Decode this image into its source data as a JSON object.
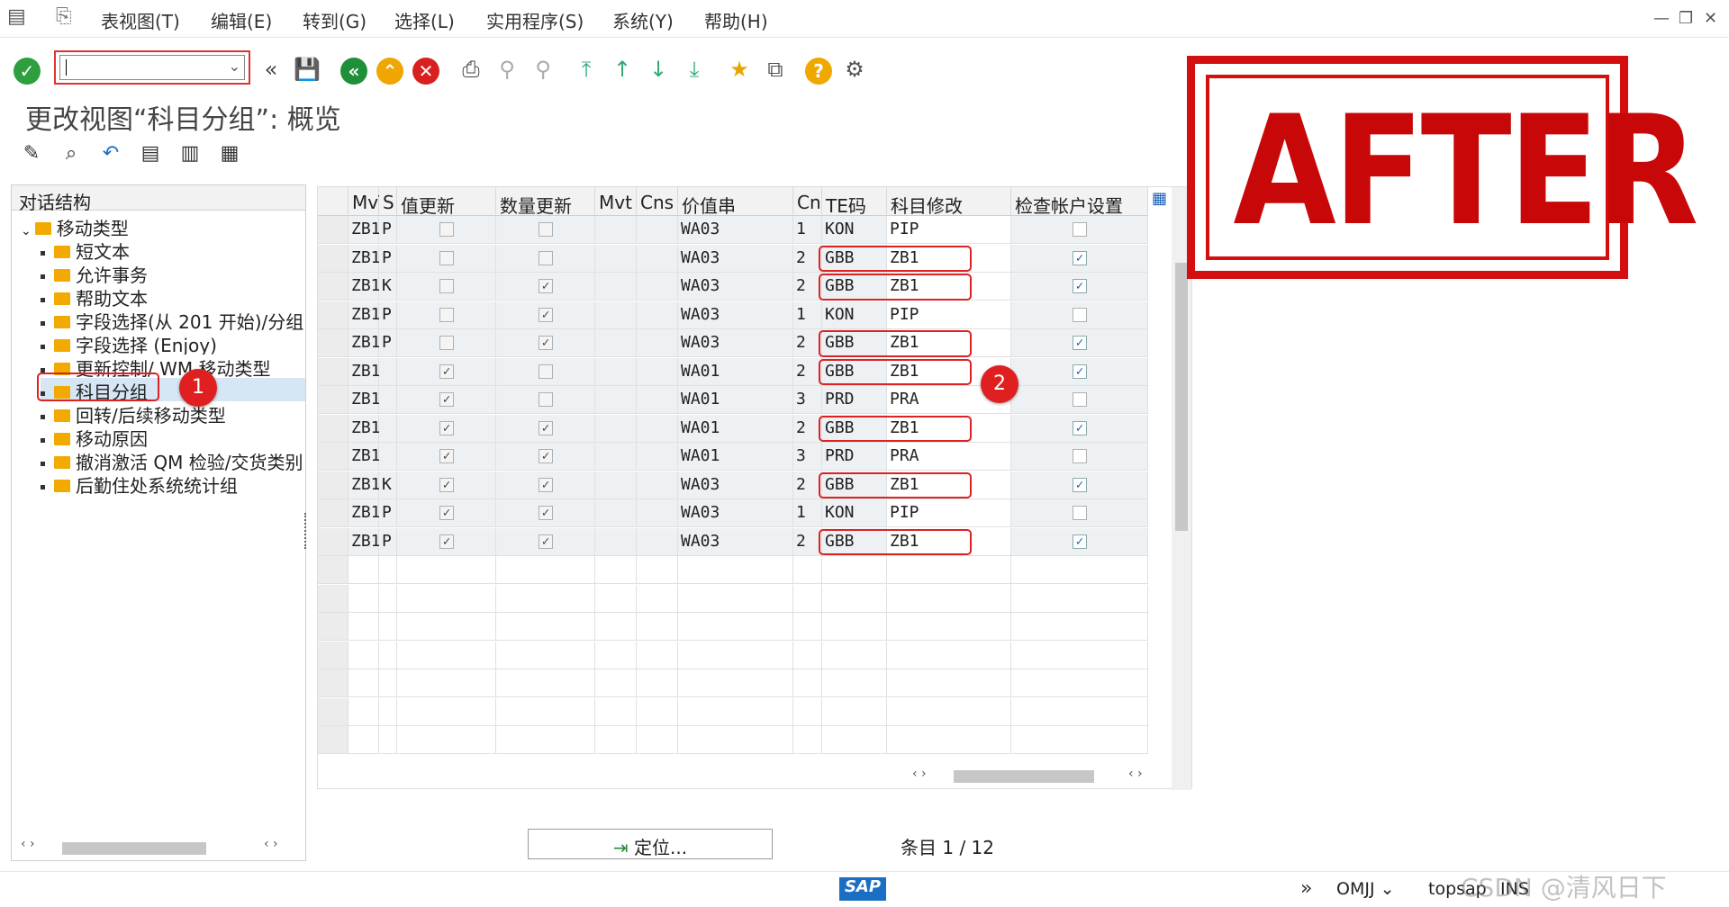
{
  "menu": {
    "items": [
      "表视图(T)",
      "编辑(E)",
      "转到(G)",
      "选择(L)",
      "实用程序(S)",
      "系统(Y)",
      "帮助(H)"
    ]
  },
  "toolbar": {
    "command_value": ""
  },
  "page": {
    "title": "更改视图“科目分组”: 概览"
  },
  "tree": {
    "header": "对话结构",
    "root": "移动类型",
    "children": [
      "短文本",
      "允许事务",
      "帮助文本",
      "字段选择(从 201 开始)/分组",
      "字段选择 (Enjoy)",
      "更新控制/ WM 移动类型",
      "科目分组",
      "回转/后续移动类型",
      "移动原因",
      "撤消激活 QM 检验/交货类别",
      "后勤住处系统统计组"
    ],
    "selected_index": 6
  },
  "table": {
    "columns": [
      "MvT",
      "S",
      "值更新",
      "数量更新",
      "Mvt",
      "Cns",
      "价值串",
      "Cn",
      "TE码",
      "科目修改",
      "检查帐户设置"
    ],
    "rows": [
      {
        "mvt": "ZB1",
        "s": "P",
        "val": false,
        "qty": false,
        "vs": "WA03",
        "cn": "1",
        "te": "KON",
        "acc": "PIP",
        "chk": false
      },
      {
        "mvt": "ZB1",
        "s": "P",
        "val": false,
        "qty": false,
        "vs": "WA03",
        "cn": "2",
        "te": "GBB",
        "acc": "ZB1",
        "chk": true
      },
      {
        "mvt": "ZB1",
        "s": "K",
        "val": false,
        "qty": true,
        "vs": "WA03",
        "cn": "2",
        "te": "GBB",
        "acc": "ZB1",
        "chk": true
      },
      {
        "mvt": "ZB1",
        "s": "P",
        "val": false,
        "qty": true,
        "vs": "WA03",
        "cn": "1",
        "te": "KON",
        "acc": "PIP",
        "chk": false
      },
      {
        "mvt": "ZB1",
        "s": "P",
        "val": false,
        "qty": true,
        "vs": "WA03",
        "cn": "2",
        "te": "GBB",
        "acc": "ZB1",
        "chk": true
      },
      {
        "mvt": "ZB1",
        "s": "",
        "val": true,
        "qty": false,
        "vs": "WA01",
        "cn": "2",
        "te": "GBB",
        "acc": "ZB1",
        "chk": true
      },
      {
        "mvt": "ZB1",
        "s": "",
        "val": true,
        "qty": false,
        "vs": "WA01",
        "cn": "3",
        "te": "PRD",
        "acc": "PRA",
        "chk": false
      },
      {
        "mvt": "ZB1",
        "s": "",
        "val": true,
        "qty": true,
        "vs": "WA01",
        "cn": "2",
        "te": "GBB",
        "acc": "ZB1",
        "chk": true
      },
      {
        "mvt": "ZB1",
        "s": "",
        "val": true,
        "qty": true,
        "vs": "WA01",
        "cn": "3",
        "te": "PRD",
        "acc": "PRA",
        "chk": false
      },
      {
        "mvt": "ZB1",
        "s": "K",
        "val": true,
        "qty": true,
        "vs": "WA03",
        "cn": "2",
        "te": "GBB",
        "acc": "ZB1",
        "chk": true
      },
      {
        "mvt": "ZB1",
        "s": "P",
        "val": true,
        "qty": true,
        "vs": "WA03",
        "cn": "1",
        "te": "KON",
        "acc": "PIP",
        "chk": false
      },
      {
        "mvt": "ZB1",
        "s": "P",
        "val": true,
        "qty": true,
        "vs": "WA03",
        "cn": "2",
        "te": "GBB",
        "acc": "ZB1",
        "chk": true
      }
    ]
  },
  "annotations": {
    "badge1": "1",
    "badge2": "2"
  },
  "stamp": {
    "text": "AFTER"
  },
  "footer": {
    "position_button": "定位...",
    "entry_label": "条目",
    "entry_value": "1 / 12"
  },
  "status": {
    "transaction": "OMJJ",
    "system": "topsap",
    "mode": "INS",
    "logo": "SAP",
    "watermark": "CSDN @清风日下"
  },
  "colors": {
    "accent_red": "#d40f0f",
    "folder": "#f2a900",
    "check_blue": "#1a5fb4"
  }
}
